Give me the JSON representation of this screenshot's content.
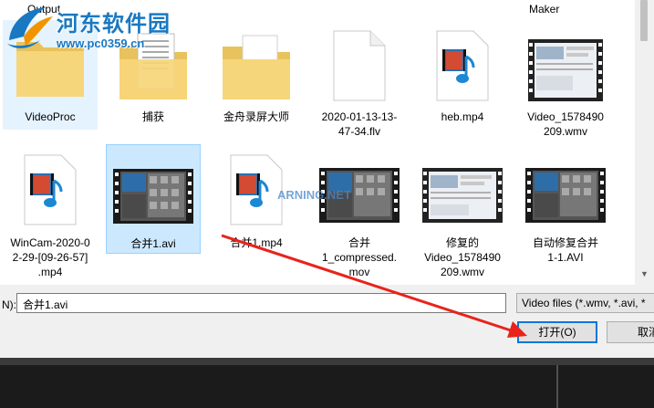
{
  "watermark": {
    "title": "河东软件园",
    "url": "www.pc0359.cn",
    "mid_text": "ARNING.NET"
  },
  "files": [
    {
      "name": "Output",
      "kind": "folder-app"
    },
    {
      "name": "VideoProc",
      "kind": "folder-app"
    },
    {
      "name": "捕获",
      "kind": "folder-doc"
    },
    {
      "name": "金舟录屏大师",
      "kind": "folder-doc"
    },
    {
      "name": "2020-01-13-13-\n47-34.flv",
      "kind": "blank"
    },
    {
      "name": "heb.mp4",
      "kind": "media"
    },
    {
      "name": "Maker",
      "kind": "header"
    },
    {
      "name": "Video_1578490\n209.wmv",
      "kind": "video"
    },
    {
      "name": "WinCam-2020-0\n2-29-[09-26-57]\n.mp4",
      "kind": "media"
    },
    {
      "name": "合并1.avi",
      "kind": "video"
    },
    {
      "name": "合并1.mp4",
      "kind": "media"
    },
    {
      "name": "合并\n1_compressed.\nmov",
      "kind": "video"
    },
    {
      "name": "修复的\nVideo_1578490\n209.wmv",
      "kind": "video"
    },
    {
      "name": "自动修复合并\n1-1.AVI",
      "kind": "video"
    }
  ],
  "footer": {
    "filename_label": "N):",
    "filename_value": "合并1.avi",
    "filter_label": "Video files (*.wmv, *.avi, *",
    "open_button": "打开(O)",
    "cancel_button": "取消"
  },
  "colors": {
    "selection": "#cce8ff",
    "accent": "#0078d7",
    "arrow": "#e8231b"
  }
}
